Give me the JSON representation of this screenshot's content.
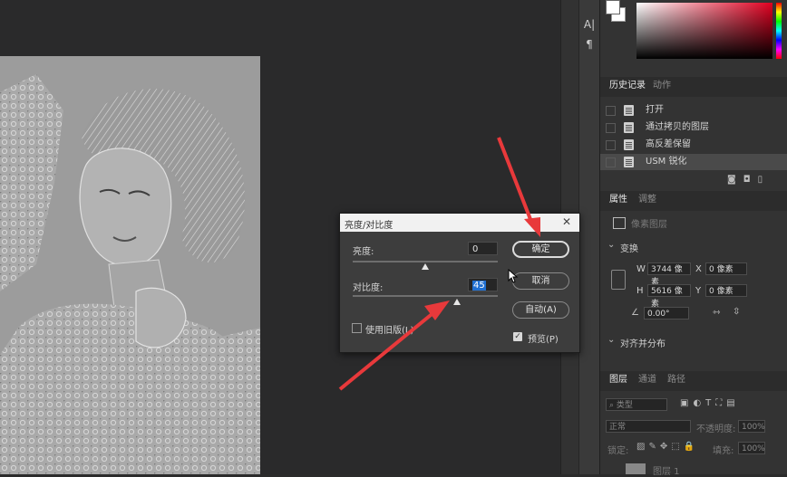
{
  "panel_tabs": {
    "history": "历史记录",
    "actions": "动作",
    "properties": "属性",
    "adjustments": "调整",
    "layers": "图层",
    "channels": "通道",
    "paths": "路径"
  },
  "history_items": [
    {
      "label": "打开",
      "selected": false
    },
    {
      "label": "通过拷贝的图层",
      "selected": false
    },
    {
      "label": "高反差保留",
      "selected": false
    },
    {
      "label": "USM 锐化",
      "selected": true
    }
  ],
  "properties": {
    "layer_type": "像素图层",
    "transform_header": "变换",
    "w_label": "W",
    "w_value": "3744 像素",
    "x_label": "X",
    "x_value": "0 像素",
    "h_label": "H",
    "h_value": "5616 像素",
    "y_label": "Y",
    "y_value": "0 像素",
    "angle_value": "0.00°",
    "align_header": "对齐并分布"
  },
  "layers_panel": {
    "filter_type": "类型",
    "blend_mode": "正常",
    "opacity_label": "不透明度:",
    "opacity_value": "100%",
    "lock_label": "锁定:",
    "fill_label": "填充:",
    "fill_value": "100%",
    "layer_name": "图层 1"
  },
  "dialog": {
    "title": "亮度/对比度",
    "brightness_label": "亮度:",
    "brightness_value": "0",
    "contrast_label": "对比度:",
    "contrast_value": "45",
    "ok": "确定",
    "cancel": "取消",
    "auto": "自动(A)",
    "legacy": "使用旧版(L)",
    "preview": "预览(P)",
    "brightness_level": 0.5,
    "contrast_level": 0.72,
    "legacy_checked": false,
    "preview_checked": true
  },
  "narrow_tools": [
    "A|",
    "¶"
  ],
  "colors": {
    "accent": "#1f6fd1",
    "arrow": "#e8393b"
  }
}
